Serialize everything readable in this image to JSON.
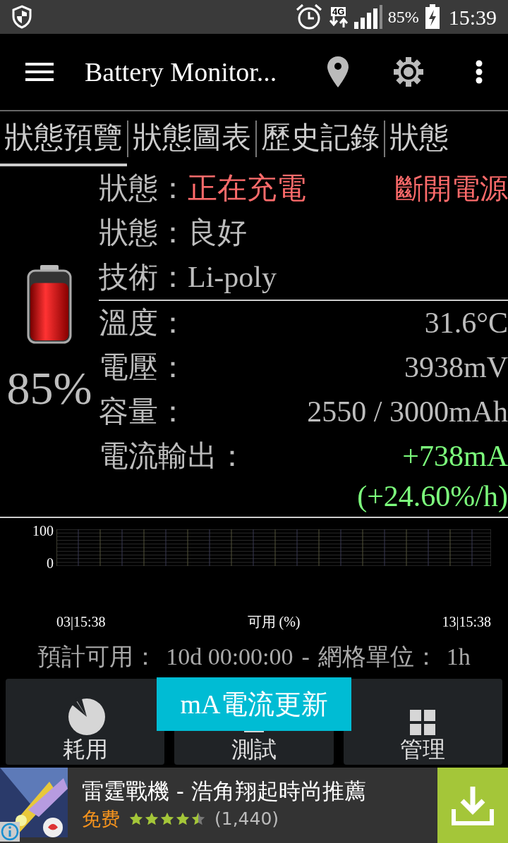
{
  "status_bar": {
    "battery_percent": "85%",
    "time": "15:39",
    "network": "4G"
  },
  "app_bar": {
    "title": "Battery Monitor..."
  },
  "tabs": [
    {
      "label": "狀態預覽",
      "selected": true
    },
    {
      "label": "狀態圖表",
      "selected": false
    },
    {
      "label": "歷史記錄",
      "selected": false
    },
    {
      "label": "狀態",
      "selected": false
    }
  ],
  "battery": {
    "level": 0.85,
    "percent": "85%"
  },
  "info_rows": [
    {
      "label": "狀態：",
      "value": "正在充電",
      "kind": "alert",
      "action": "斷開電源"
    },
    {
      "label": "狀態：",
      "value": "良好",
      "kind": "field"
    },
    {
      "label": "技術：",
      "value": "Li-poly",
      "kind": "field"
    },
    {
      "label": "溫度：",
      "value": "31.6°C",
      "kind": "reading"
    },
    {
      "label": "電壓：",
      "value": "3938mV",
      "kind": "reading"
    },
    {
      "label": "容量：",
      "value": "2550 / 3000mAh",
      "kind": "reading"
    },
    {
      "label": "電流輸出：",
      "value": "+738mA",
      "kind": "positive",
      "extra": "(+24.60%/h)"
    }
  ],
  "graph": {
    "y_max": "100",
    "y_min": "0",
    "x_start": "03|15:38",
    "x_label": "可用 (%)",
    "x_end": "13|15:38"
  },
  "estimate": {
    "label": "預計可用：",
    "value": "10d 00:00:00",
    "separator": "-",
    "grid_label": "網格單位：",
    "grid_value": "1h"
  },
  "bottom_buttons": [
    {
      "label": "耗用",
      "kind": "pie"
    },
    {
      "label": "測試",
      "kind": "test"
    },
    {
      "label": "管理",
      "kind": "grid"
    }
  ],
  "toast": "mA電流更新",
  "ad": {
    "title": "雷霆戰機 - 浩角翔起時尚推薦",
    "price": "免费",
    "stars": 4.5,
    "count": "(1,440)"
  }
}
